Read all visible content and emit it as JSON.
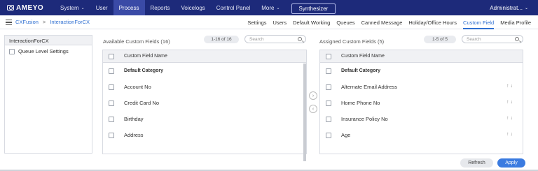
{
  "brand": {
    "name": "AMEYO"
  },
  "topnav": {
    "items": [
      {
        "label": "System",
        "has_caret": true,
        "active": false
      },
      {
        "label": "User",
        "has_caret": false,
        "active": false
      },
      {
        "label": "Process",
        "has_caret": false,
        "active": true
      },
      {
        "label": "Reports",
        "has_caret": false,
        "active": false
      },
      {
        "label": "Voicelogs",
        "has_caret": false,
        "active": false
      },
      {
        "label": "Control Panel",
        "has_caret": false,
        "active": false
      },
      {
        "label": "More",
        "has_caret": true,
        "active": false
      }
    ],
    "synthesizer_label": "Synthesizer",
    "user_label": "Administrat..."
  },
  "breadcrumb": {
    "root": "CXFusion",
    "separator": ">",
    "current": "InteractionForCX"
  },
  "tabs": [
    {
      "label": "Settings",
      "active": false
    },
    {
      "label": "Users",
      "active": false
    },
    {
      "label": "Default Working",
      "active": false
    },
    {
      "label": "Queues",
      "active": false
    },
    {
      "label": "Canned Message",
      "active": false
    },
    {
      "label": "Holiday/Office Hours",
      "active": false
    },
    {
      "label": "Custom Field",
      "active": true
    },
    {
      "label": "Media Profile",
      "active": false
    }
  ],
  "tree": {
    "header": "InteractionForCX",
    "items": [
      {
        "label": "Queue Level Settings"
      }
    ]
  },
  "available": {
    "title": "Available Custom Fields (16)",
    "pager": "1-16 of 16",
    "search_placeholder": "Search",
    "column_header": "Custom Field Name",
    "rows": [
      {
        "label": "Default Category",
        "bold": true
      },
      {
        "label": "Account No",
        "bold": false
      },
      {
        "label": "Credit Card No",
        "bold": false
      },
      {
        "label": "Birthday",
        "bold": false
      },
      {
        "label": "Address",
        "bold": false
      }
    ]
  },
  "assigned": {
    "title": "Assigned Custom Fields (5)",
    "pager": "1-5 of 5",
    "search_placeholder": "Search",
    "column_header": "Custom Field Name",
    "sort_arrows": "↑↓",
    "rows": [
      {
        "label": "Default Category",
        "bold": true,
        "sortable": false
      },
      {
        "label": "Alternate Email Address",
        "bold": false,
        "sortable": true
      },
      {
        "label": "Home Phone No",
        "bold": false,
        "sortable": true
      },
      {
        "label": "Insurance Policy No",
        "bold": false,
        "sortable": true
      },
      {
        "label": "Age",
        "bold": false,
        "sortable": true
      }
    ]
  },
  "move_buttons": {
    "right": "›",
    "left": "‹"
  },
  "actions": {
    "refresh": "Refresh",
    "apply": "Apply"
  },
  "colors": {
    "nav_bg": "#1d2a7a",
    "nav_active": "#3a4aa6",
    "accent": "#2f6fd1",
    "apply_bg": "#3b7be0"
  }
}
